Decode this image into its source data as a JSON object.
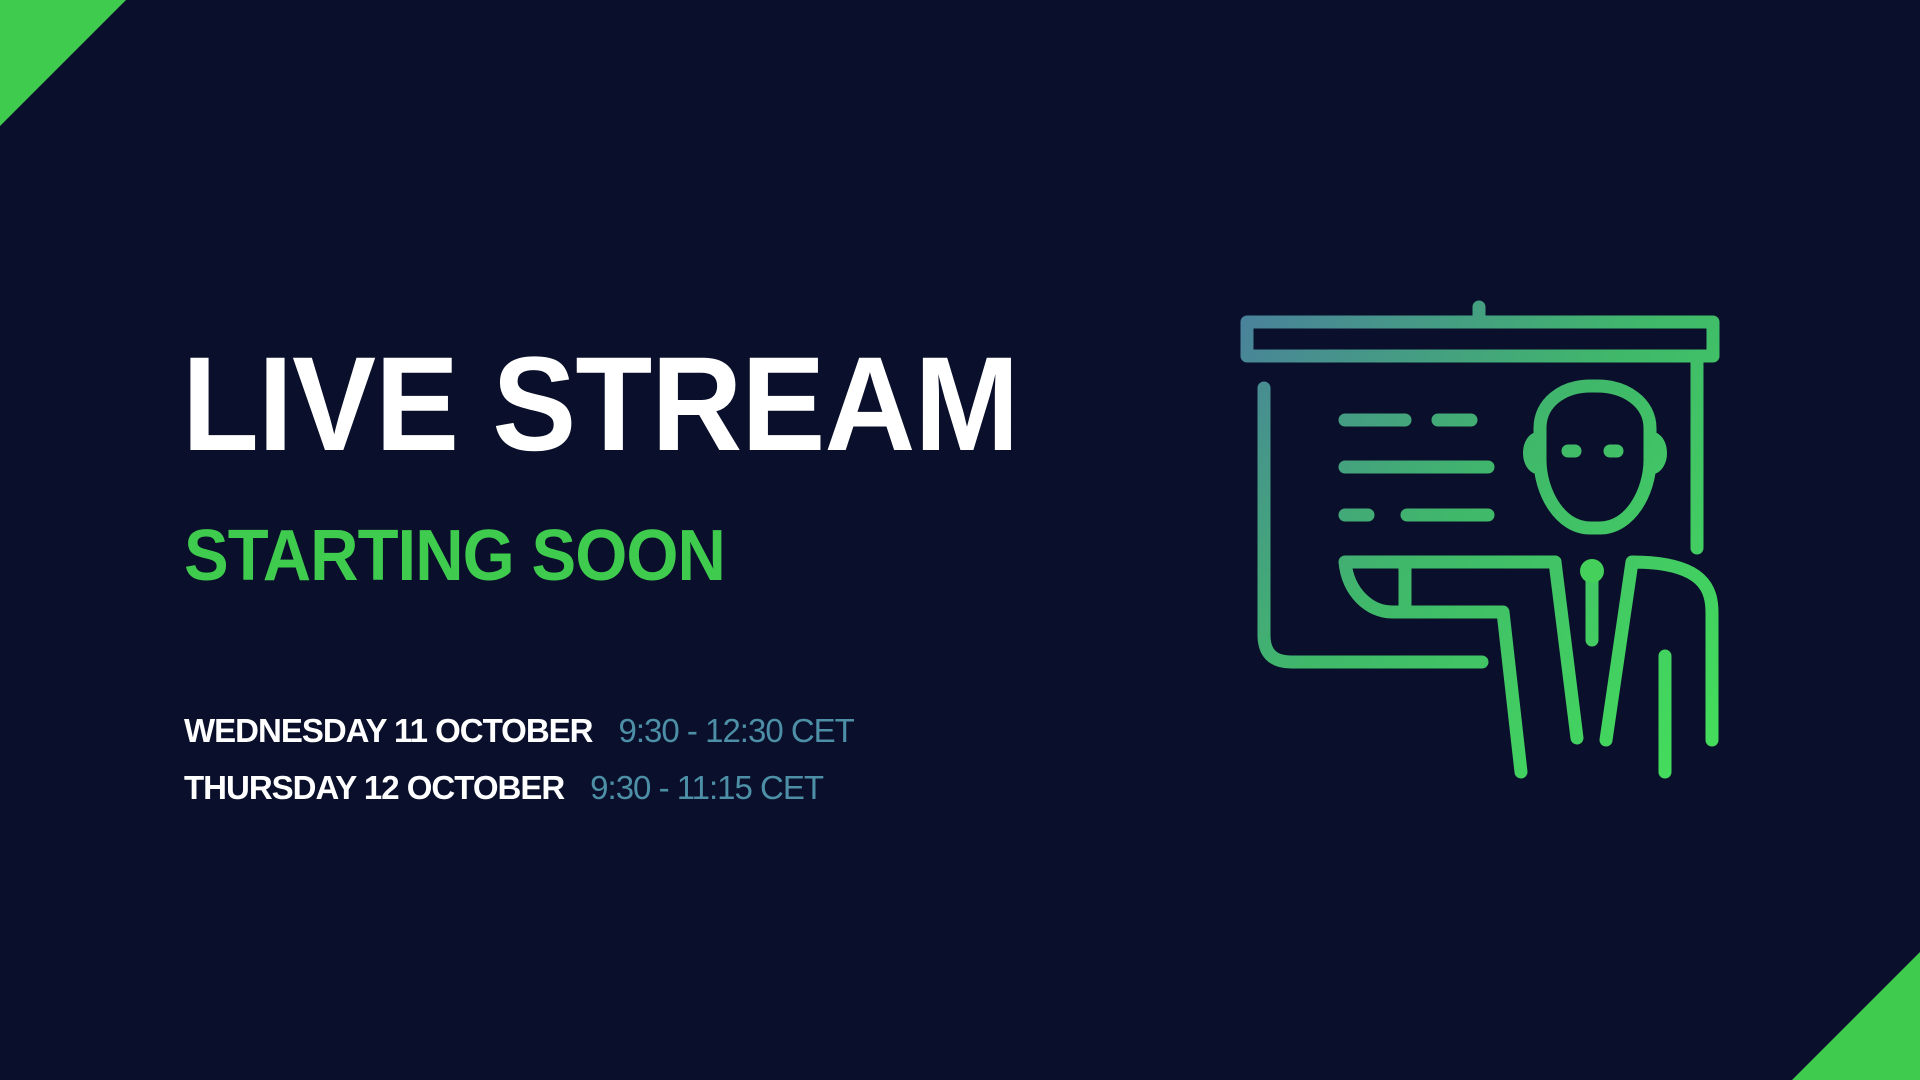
{
  "title": "LIVE STREAM",
  "subtitle": "STARTING SOON",
  "schedule": [
    {
      "day": "WEDNESDAY 11 OCTOBER",
      "time": "9:30 - 12:30 CET"
    },
    {
      "day": "THURSDAY 12 OCTOBER",
      "time": "9:30 - 11:15 CET"
    }
  ],
  "illustration": {
    "icon": "presenter-at-screen-icon"
  },
  "colors": {
    "background": "#0a102b",
    "accent_green": "#3fcc4e",
    "accent_teal": "#4d8fa6",
    "text_white": "#ffffff"
  }
}
